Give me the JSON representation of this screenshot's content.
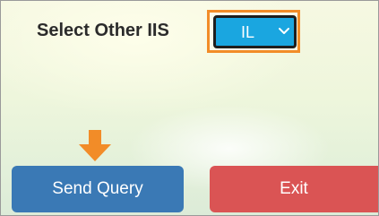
{
  "form": {
    "label": "Select Other IIS",
    "selected_iis": "IL"
  },
  "icons": {
    "dropdown": "chevron-down-icon",
    "pointer": "arrow-down-icon"
  },
  "buttons": {
    "send_query": "Send Query",
    "exit": "Exit"
  },
  "colors": {
    "highlight": "#f28c28",
    "select_bg": "#1aa6e0",
    "send_bg": "#3a79b5",
    "exit_bg": "#da5454"
  }
}
